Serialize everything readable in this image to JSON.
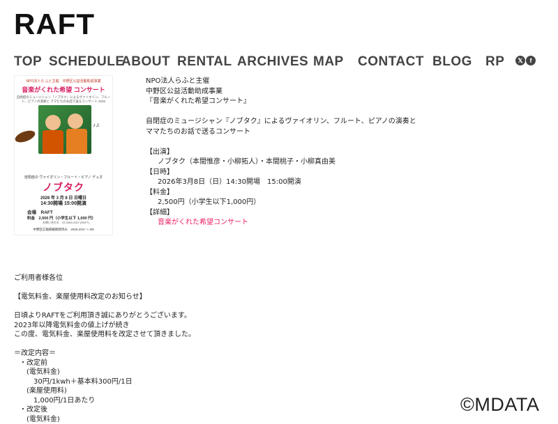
{
  "site": {
    "logo": "RAFT"
  },
  "nav": {
    "items": [
      "TOP",
      "SCHEDULE",
      "ABOUT",
      "RENTAL",
      "ARCHIVES",
      "MAP",
      "CONTACT",
      "BLOG",
      "RP"
    ],
    "x_icon": "x-icon",
    "facebook_icon": "facebook-icon"
  },
  "flyer": {
    "top_line": "NPO法人ら ふと主催　中野区公益活動助成事業",
    "title": "音楽がくれた希望 コンサート",
    "sub": "自閉症のミュージシャン「ノブタク」によるヴァイオリン、フルート、ピアノの演奏と ママたちのお話で送るコンサート 2026",
    "instruments": "自閉症の ヴァイオリン・フルート・ピアノ デュオ",
    "name": "ノブタク",
    "date": "2026 年 3 月 8 日 日曜日",
    "time": "14:30開場 15:00開演",
    "venue": "会場　RAFT",
    "price": "料金　2,500 円（小学生以下 1,000 円）",
    "contact": "お問い合わせ　03-3365-0307 (RAFT)",
    "footer": "中野区広報掲載期間済み　2026.2/24 ～ 3/9"
  },
  "event": {
    "organizer": "NPO法人らふと主催",
    "grant": "中野区公益活動助成事業",
    "title": "『音楽がくれた希望コンサート』",
    "desc1": "自閉症のミュージシャン『ノブタク』によるヴァイオリン、フルート、ピアノの演奏と",
    "desc2": "ママたちのお話で送るコンサート",
    "performers_label": "【出演】",
    "performers": "ノブタク（本間惟彦・小柳拓人）・本間桃子・小柳真由美",
    "datetime_label": "【日時】",
    "datetime": "2026年3月8日（日）14:30開場　15:00開演",
    "price_label": "【料金】",
    "price": "2,500円（小学生以下1,000円）",
    "details_label": "【詳細】",
    "details_link": "音楽がくれた希望コンサート"
  },
  "notice": {
    "greeting": "ご利用者様各位",
    "heading": "【電気料金、楽屋使用料改定のお知らせ】",
    "line1": "日頃よりRAFTをご利用頂き誠にありがとうございます。",
    "line2": "2023年以降電気料金の値上げが続き",
    "line3": "この度、電気料金、楽屋使用料を改定させて頂きました。",
    "contents": "＝改定内容＝",
    "before": "・改定前",
    "elec_label": "(電気料金)",
    "elec_value": "30円/1kwh＋基本料300円/1日",
    "green_label": "(楽屋使用料)",
    "green_value": "1,000円/1日あたり",
    "after": "・改定後",
    "elec_label2": "(電気料金)"
  },
  "watermark": "©MDATA"
}
